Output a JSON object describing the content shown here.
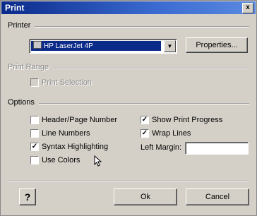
{
  "window": {
    "title": "Print",
    "close_glyph": "x"
  },
  "printer": {
    "group_label": "Printer",
    "selected": "HP LaserJet 4P",
    "properties_label": "Properties..."
  },
  "print_range": {
    "group_label": "Print Range",
    "print_selection_label": "Print Selection",
    "print_selection_checked": false
  },
  "options": {
    "group_label": "Options",
    "header_page_number": {
      "label": "Header/Page Number",
      "checked": false
    },
    "line_numbers": {
      "label": "Line Numbers",
      "checked": false
    },
    "syntax_highlighting": {
      "label": "Syntax Highlighting",
      "checked": true
    },
    "use_colors": {
      "label": "Use Colors",
      "checked": false
    },
    "show_print_progress": {
      "label": "Show Print Progress",
      "checked": true
    },
    "wrap_lines": {
      "label": "Wrap Lines",
      "checked": true
    },
    "left_margin_label": "Left Margin:",
    "left_margin_value": ""
  },
  "footer": {
    "help_label": "?",
    "ok_label": "Ok",
    "cancel_label": "Cancel"
  }
}
